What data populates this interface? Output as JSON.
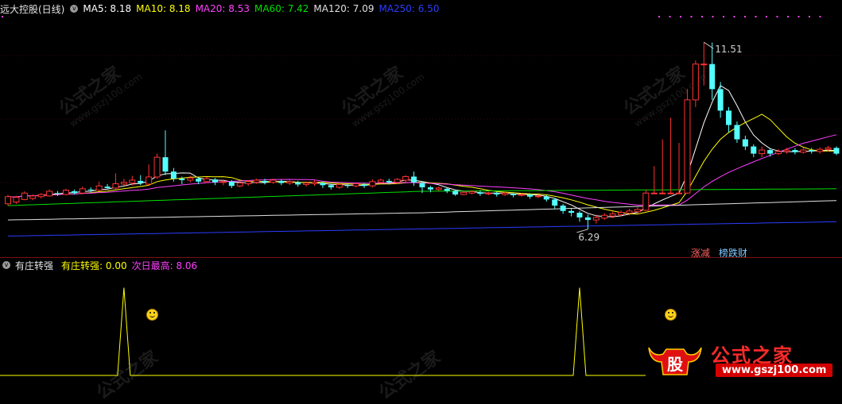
{
  "main_legend": {
    "title": "远大控股(日线)",
    "items": [
      {
        "label": "MA5: 8.18",
        "color": "#ffffff"
      },
      {
        "label": "MA10: 8.18",
        "color": "#ffff00"
      },
      {
        "label": "MA20: 8.53",
        "color": "#ff40ff"
      },
      {
        "label": "MA60: 7.42",
        "color": "#00e000"
      },
      {
        "label": "MA120: 7.09",
        "color": "#e0e0e0"
      },
      {
        "label": "MA250: 6.50",
        "color": "#2b3cff"
      }
    ]
  },
  "sub_legend": {
    "title": "有庄转强",
    "items": [
      {
        "label": "有庄转强: 0.00",
        "color": "#ffff00"
      },
      {
        "label": "次日最高: 8.06",
        "color": "#ff40ff"
      }
    ]
  },
  "tags": {
    "zhang_jian": "涨减",
    "bang_die_cai": "榜跌财"
  },
  "watermark": {
    "cn": "公式之家",
    "url": "www.gszj100.com"
  },
  "brand": {
    "cn": "公式之家",
    "url": "www.gszj100.com",
    "logo_text": "股"
  },
  "colors": {
    "up": "#ff3232",
    "down": "#54ffff",
    "bg": "#000000",
    "grid": "#7a1010"
  },
  "chart_data": [
    {
      "type": "candlestick",
      "title": "远大控股(日线)",
      "annotations": [
        {
          "label": "11.51",
          "kind": "high"
        },
        {
          "label": "6.29",
          "kind": "low"
        }
      ],
      "ylim": [
        5.6,
        12.2
      ],
      "candles": [
        [
          7.0,
          7.2,
          6.95,
          7.25
        ],
        [
          7.05,
          7.18,
          7.0,
          7.22
        ],
        [
          7.12,
          7.3,
          7.1,
          7.35
        ],
        [
          7.15,
          7.22,
          7.1,
          7.26
        ],
        [
          7.2,
          7.26,
          7.15,
          7.3
        ],
        [
          7.22,
          7.35,
          7.2,
          7.4
        ],
        [
          7.3,
          7.28,
          7.22,
          7.36
        ],
        [
          7.26,
          7.38,
          7.24,
          7.42
        ],
        [
          7.35,
          7.3,
          7.26,
          7.4
        ],
        [
          7.3,
          7.42,
          7.28,
          7.48
        ],
        [
          7.4,
          7.38,
          7.32,
          7.46
        ],
        [
          7.38,
          7.5,
          7.35,
          7.62
        ],
        [
          7.48,
          7.44,
          7.4,
          7.55
        ],
        [
          7.44,
          7.56,
          7.4,
          7.85
        ],
        [
          7.55,
          7.6,
          7.5,
          7.7
        ],
        [
          7.58,
          7.66,
          7.5,
          7.78
        ],
        [
          7.64,
          7.58,
          7.52,
          7.8
        ],
        [
          7.55,
          7.75,
          7.5,
          8.1
        ],
        [
          7.75,
          8.3,
          7.7,
          8.4
        ],
        [
          8.3,
          7.9,
          7.8,
          9.05
        ],
        [
          7.9,
          7.7,
          7.62,
          8.0
        ],
        [
          7.7,
          7.66,
          7.55,
          7.76
        ],
        [
          7.66,
          7.72,
          7.6,
          7.78
        ],
        [
          7.7,
          7.62,
          7.55,
          7.74
        ],
        [
          7.62,
          7.7,
          7.58,
          7.75
        ],
        [
          7.68,
          7.6,
          7.52,
          7.72
        ],
        [
          7.6,
          7.62,
          7.52,
          7.68
        ],
        [
          7.62,
          7.5,
          7.44,
          7.66
        ],
        [
          7.5,
          7.58,
          7.46,
          7.64
        ],
        [
          7.56,
          7.62,
          7.5,
          7.66
        ],
        [
          7.6,
          7.66,
          7.56,
          7.7
        ],
        [
          7.64,
          7.6,
          7.54,
          7.7
        ],
        [
          7.6,
          7.66,
          7.56,
          7.7
        ],
        [
          7.64,
          7.58,
          7.52,
          7.68
        ],
        [
          7.58,
          7.62,
          7.52,
          7.66
        ],
        [
          7.6,
          7.54,
          7.48,
          7.64
        ],
        [
          7.54,
          7.58,
          7.48,
          7.62
        ],
        [
          7.56,
          7.6,
          7.5,
          7.66
        ],
        [
          7.58,
          7.52,
          7.44,
          7.62
        ],
        [
          7.52,
          7.46,
          7.4,
          7.56
        ],
        [
          7.46,
          7.54,
          7.42,
          7.58
        ],
        [
          7.52,
          7.5,
          7.44,
          7.56
        ],
        [
          7.5,
          7.56,
          7.46,
          7.6
        ],
        [
          7.54,
          7.5,
          7.44,
          7.58
        ],
        [
          7.5,
          7.62,
          7.46,
          7.68
        ],
        [
          7.6,
          7.66,
          7.56,
          7.7
        ],
        [
          7.64,
          7.6,
          7.54,
          7.7
        ],
        [
          7.6,
          7.68,
          7.56,
          7.72
        ],
        [
          7.66,
          7.76,
          7.6,
          7.8
        ],
        [
          7.76,
          7.6,
          7.5,
          7.9
        ],
        [
          7.58,
          7.46,
          7.3,
          7.62
        ],
        [
          7.46,
          7.4,
          7.32,
          7.5
        ],
        [
          7.4,
          7.44,
          7.36,
          7.48
        ],
        [
          7.42,
          7.36,
          7.3,
          7.46
        ],
        [
          7.36,
          7.26,
          7.22,
          7.4
        ],
        [
          7.26,
          7.32,
          7.24,
          7.36
        ],
        [
          7.3,
          7.34,
          7.26,
          7.38
        ],
        [
          7.32,
          7.28,
          7.22,
          7.38
        ],
        [
          7.28,
          7.3,
          7.24,
          7.34
        ],
        [
          7.3,
          7.26,
          7.2,
          7.34
        ],
        [
          7.26,
          7.3,
          7.22,
          7.34
        ],
        [
          7.28,
          7.24,
          7.18,
          7.32
        ],
        [
          7.24,
          7.26,
          7.2,
          7.3
        ],
        [
          7.26,
          7.2,
          7.14,
          7.3
        ],
        [
          7.2,
          7.22,
          7.16,
          7.26
        ],
        [
          7.2,
          7.12,
          7.06,
          7.24
        ],
        [
          7.12,
          6.95,
          6.85,
          7.16
        ],
        [
          6.95,
          6.8,
          6.72,
          7.0
        ],
        [
          6.8,
          6.75,
          6.65,
          6.86
        ],
        [
          6.75,
          6.62,
          6.5,
          6.8
        ],
        [
          6.62,
          6.55,
          6.29,
          6.7
        ],
        [
          6.55,
          6.62,
          6.45,
          6.7
        ],
        [
          6.6,
          6.68,
          6.55,
          6.74
        ],
        [
          6.66,
          6.72,
          6.6,
          6.78
        ],
        [
          6.7,
          6.76,
          6.64,
          6.82
        ],
        [
          6.74,
          6.8,
          6.68,
          6.86
        ],
        [
          6.78,
          6.84,
          6.72,
          6.9
        ],
        [
          6.82,
          7.3,
          6.8,
          7.4
        ],
        [
          7.3,
          7.3,
          7.28,
          8.05
        ],
        [
          7.3,
          7.3,
          7.28,
          8.8
        ],
        [
          7.3,
          7.3,
          7.28,
          9.4
        ],
        [
          7.3,
          7.3,
          7.28,
          8.7
        ],
        [
          7.3,
          9.9,
          7.28,
          10.2
        ],
        [
          9.9,
          10.9,
          9.7,
          11.0
        ],
        [
          10.9,
          10.9,
          10.3,
          11.51
        ],
        [
          10.9,
          10.2,
          9.9,
          11.5
        ],
        [
          10.2,
          9.6,
          9.4,
          10.4
        ],
        [
          9.6,
          9.2,
          9.0,
          9.7
        ],
        [
          9.2,
          8.8,
          8.7,
          9.3
        ],
        [
          8.8,
          8.6,
          8.5,
          8.9
        ],
        [
          8.6,
          8.4,
          8.3,
          8.66
        ],
        [
          8.4,
          8.5,
          8.3,
          8.6
        ],
        [
          8.5,
          8.4,
          8.32,
          8.56
        ],
        [
          8.4,
          8.46,
          8.36,
          8.52
        ],
        [
          8.46,
          8.5,
          8.4,
          8.56
        ],
        [
          8.5,
          8.44,
          8.38,
          8.56
        ],
        [
          8.44,
          8.5,
          8.4,
          8.56
        ],
        [
          8.5,
          8.46,
          8.4,
          8.56
        ],
        [
          8.46,
          8.52,
          8.4,
          8.58
        ],
        [
          8.52,
          8.56,
          8.46,
          8.62
        ],
        [
          8.56,
          8.4,
          8.36,
          8.6
        ]
      ]
    },
    {
      "type": "line",
      "title": "有庄转强",
      "series": [
        {
          "name": "有庄转强",
          "values_by_bar": {
            "14": 1,
            "69": 1
          },
          "baseline": 0
        }
      ],
      "ylim": [
        0,
        1.15
      ]
    }
  ]
}
